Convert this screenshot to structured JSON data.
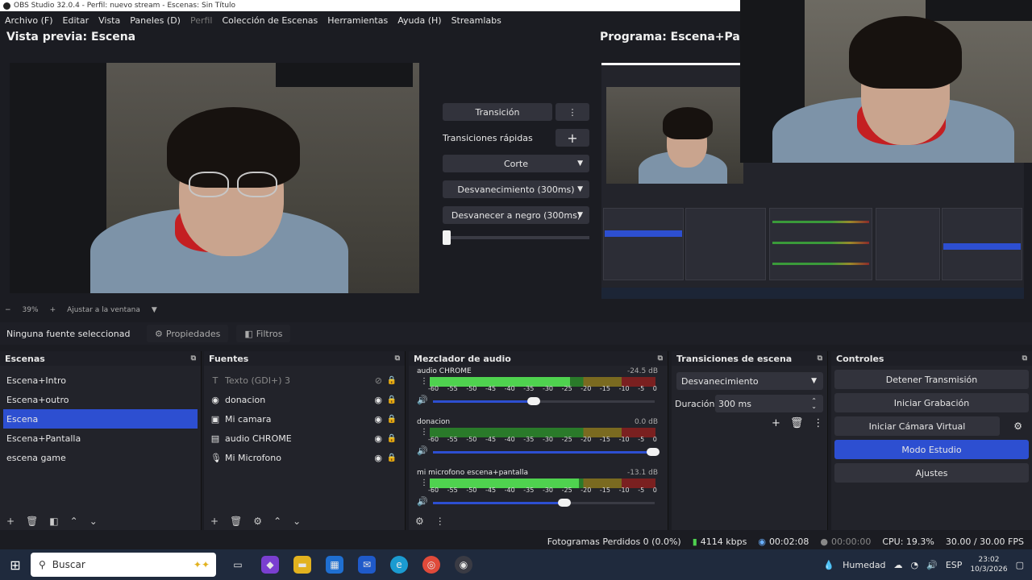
{
  "window": {
    "title": "OBS Studio 32.0.4 - Perfil: nuevo stream - Escenas: Sin Título"
  },
  "menu": [
    "Archivo (F)",
    "Editar",
    "Vista",
    "Paneles (D)",
    "Perfil",
    "Colección de Escenas",
    "Herramientas",
    "Ayuda (H)",
    "Streamlabs"
  ],
  "preview": {
    "title": "Vista previa: Escena"
  },
  "program": {
    "title": "Programa: Escena+Pan"
  },
  "zoom": {
    "minus": "−",
    "value": "39%",
    "plus": "+",
    "fit": "Ajustar a la ventana"
  },
  "transitions": {
    "transition_label": "Transición",
    "quick_label": "Transiciones rápidas",
    "options": [
      "Corte",
      "Desvanecimiento (300ms)",
      "Desvanecer a negro (300ms)"
    ]
  },
  "source_bar": {
    "none_selected": "Ninguna fuente seleccionad",
    "properties": "Propiedades",
    "filters": "Filtros"
  },
  "scenes": {
    "title": "Escenas",
    "items": [
      "Escena+Intro",
      "Escena+outro",
      "Escena",
      "Escena+Pantalla",
      "escena game"
    ],
    "selected": "Escena"
  },
  "sources": {
    "title": "Fuentes",
    "items": [
      {
        "name": "Texto (GDI+) 3",
        "icon": "text-icon"
      },
      {
        "name": "donacion",
        "icon": "browser-icon"
      },
      {
        "name": "Mi camara",
        "icon": "camera-icon"
      },
      {
        "name": "audio CHROME",
        "icon": "window-capture-icon"
      },
      {
        "name": "Mi Microfono",
        "icon": "microphone-icon"
      }
    ]
  },
  "mixer": {
    "title": "Mezclador de audio",
    "scale": [
      "-60",
      "-55",
      "-50",
      "-45",
      "-40",
      "-35",
      "-30",
      "-25",
      "-20",
      "-15",
      "-10",
      "-5",
      "0"
    ],
    "channels": [
      {
        "name": "audio CHROME",
        "db": "-24.5 dB",
        "level": 0.62,
        "volume": 0.46
      },
      {
        "name": "donacion",
        "db": "0.0 dB",
        "level": 0.0,
        "volume": 1.0
      },
      {
        "name": "mi microfono escena+pantalla",
        "db": "-13.1 dB",
        "level": 0.66,
        "volume": 0.6
      }
    ]
  },
  "scene_transitions": {
    "title": "Transiciones de escena",
    "selected": "Desvanecimiento",
    "duration_label": "Duración",
    "duration_value": "300 ms"
  },
  "controls": {
    "title": "Controles",
    "buttons": [
      "Detener Transmisión",
      "Iniciar Grabación",
      "Iniciar Cámara Virtual",
      "Modo Estudio",
      "Ajustes"
    ],
    "active": "Modo Estudio"
  },
  "status": {
    "dropped": "Fotogramas Perdidos 0 (0.0%)",
    "bitrate": "4114 kbps",
    "stream_time": "00:02:08",
    "rec_time": "00:00:00",
    "cpu": "CPU: 19.3%",
    "fps": "30.00 / 30.00 FPS"
  },
  "taskbar": {
    "search_placeholder": "Buscar",
    "weather": "Humedad",
    "lang": "ESP",
    "time": "23:02",
    "date": "10/3/2026"
  },
  "colors": {
    "accent": "#2d4fd1",
    "bg": "#1b1c22",
    "panel": "#22232a",
    "button": "#32333c"
  }
}
